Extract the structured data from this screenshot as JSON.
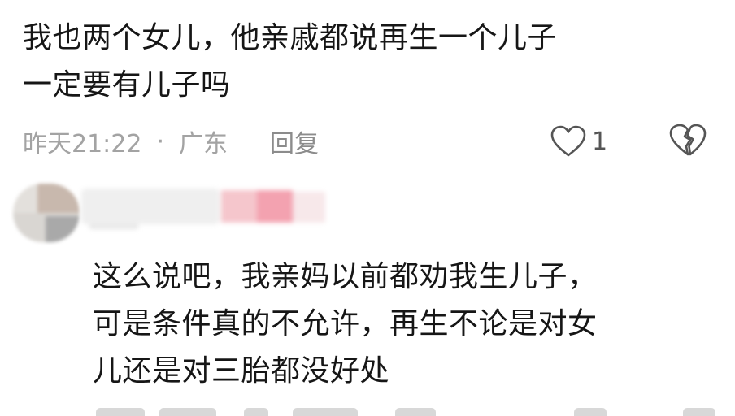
{
  "comments": [
    {
      "text": "我也两个女儿，他亲戚都说再生一个儿子\n一定要有儿子吗",
      "time": "昨天21:22",
      "separator": "·",
      "location": "广东",
      "reply_label": "回复",
      "like_count": "1"
    },
    {
      "text": "这么说吧，我亲妈以前都劝我生儿子，\n可是条件真的不允许，再生不论是对女\n儿还是对三胎都没好处"
    }
  ],
  "icons": {
    "like": "heart-outline-icon",
    "dislike": "broken-heart-icon"
  },
  "colors": {
    "text": "#161616",
    "meta": "#a3a3a3",
    "icon": "#555555"
  }
}
